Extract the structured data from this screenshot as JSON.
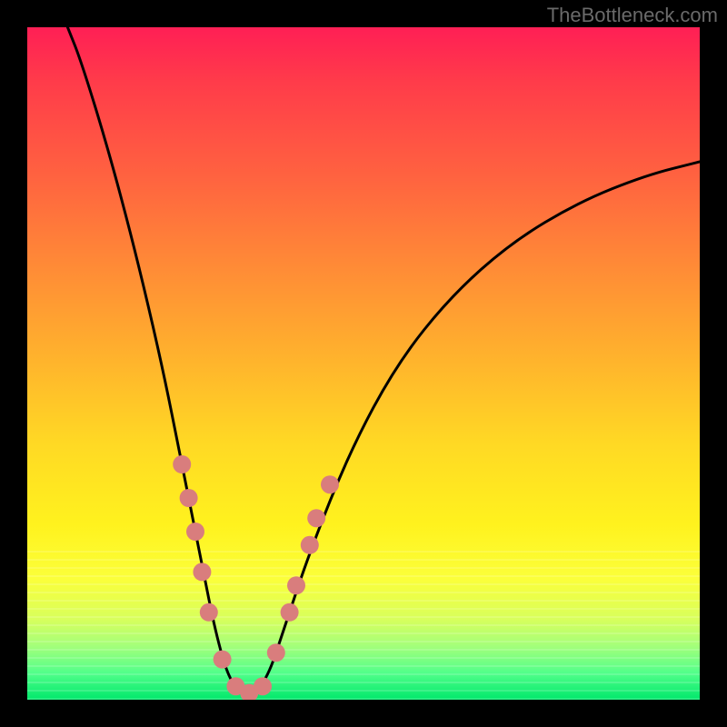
{
  "watermark": "TheBottleneck.com",
  "chart_data": {
    "type": "line",
    "title": "",
    "xlabel": "",
    "ylabel": "",
    "xlim": [
      0,
      100
    ],
    "ylim": [
      0,
      100
    ],
    "grid": false,
    "legend": false,
    "description": "V-shaped bottleneck curve plotted over a vertical heat gradient (red=high bottleneck at top, green=low at bottom). Lowest point of the curve sits in the green band near x≈30–34.",
    "curve": [
      {
        "x": 6,
        "y": 100
      },
      {
        "x": 8,
        "y": 95
      },
      {
        "x": 12,
        "y": 82
      },
      {
        "x": 16,
        "y": 67
      },
      {
        "x": 20,
        "y": 50
      },
      {
        "x": 23,
        "y": 35
      },
      {
        "x": 26,
        "y": 20
      },
      {
        "x": 28,
        "y": 10
      },
      {
        "x": 30,
        "y": 3
      },
      {
        "x": 32,
        "y": 1
      },
      {
        "x": 34,
        "y": 1
      },
      {
        "x": 36,
        "y": 4
      },
      {
        "x": 38,
        "y": 10
      },
      {
        "x": 42,
        "y": 22
      },
      {
        "x": 48,
        "y": 37
      },
      {
        "x": 55,
        "y": 50
      },
      {
        "x": 63,
        "y": 60
      },
      {
        "x": 72,
        "y": 68
      },
      {
        "x": 82,
        "y": 74
      },
      {
        "x": 92,
        "y": 78
      },
      {
        "x": 100,
        "y": 80
      }
    ],
    "dots": [
      {
        "x": 23,
        "y": 35
      },
      {
        "x": 24,
        "y": 30
      },
      {
        "x": 25,
        "y": 25
      },
      {
        "x": 26,
        "y": 19
      },
      {
        "x": 27,
        "y": 13
      },
      {
        "x": 29,
        "y": 6
      },
      {
        "x": 31,
        "y": 2
      },
      {
        "x": 33,
        "y": 1
      },
      {
        "x": 35,
        "y": 2
      },
      {
        "x": 37,
        "y": 7
      },
      {
        "x": 39,
        "y": 13
      },
      {
        "x": 40,
        "y": 17
      },
      {
        "x": 42,
        "y": 23
      },
      {
        "x": 43,
        "y": 27
      },
      {
        "x": 45,
        "y": 32
      }
    ],
    "gradient_stops": [
      {
        "pct": 0,
        "color": "#ff1f55"
      },
      {
        "pct": 50,
        "color": "#ffb52c"
      },
      {
        "pct": 80,
        "color": "#fff21e"
      },
      {
        "pct": 100,
        "color": "#00e86b"
      }
    ]
  }
}
